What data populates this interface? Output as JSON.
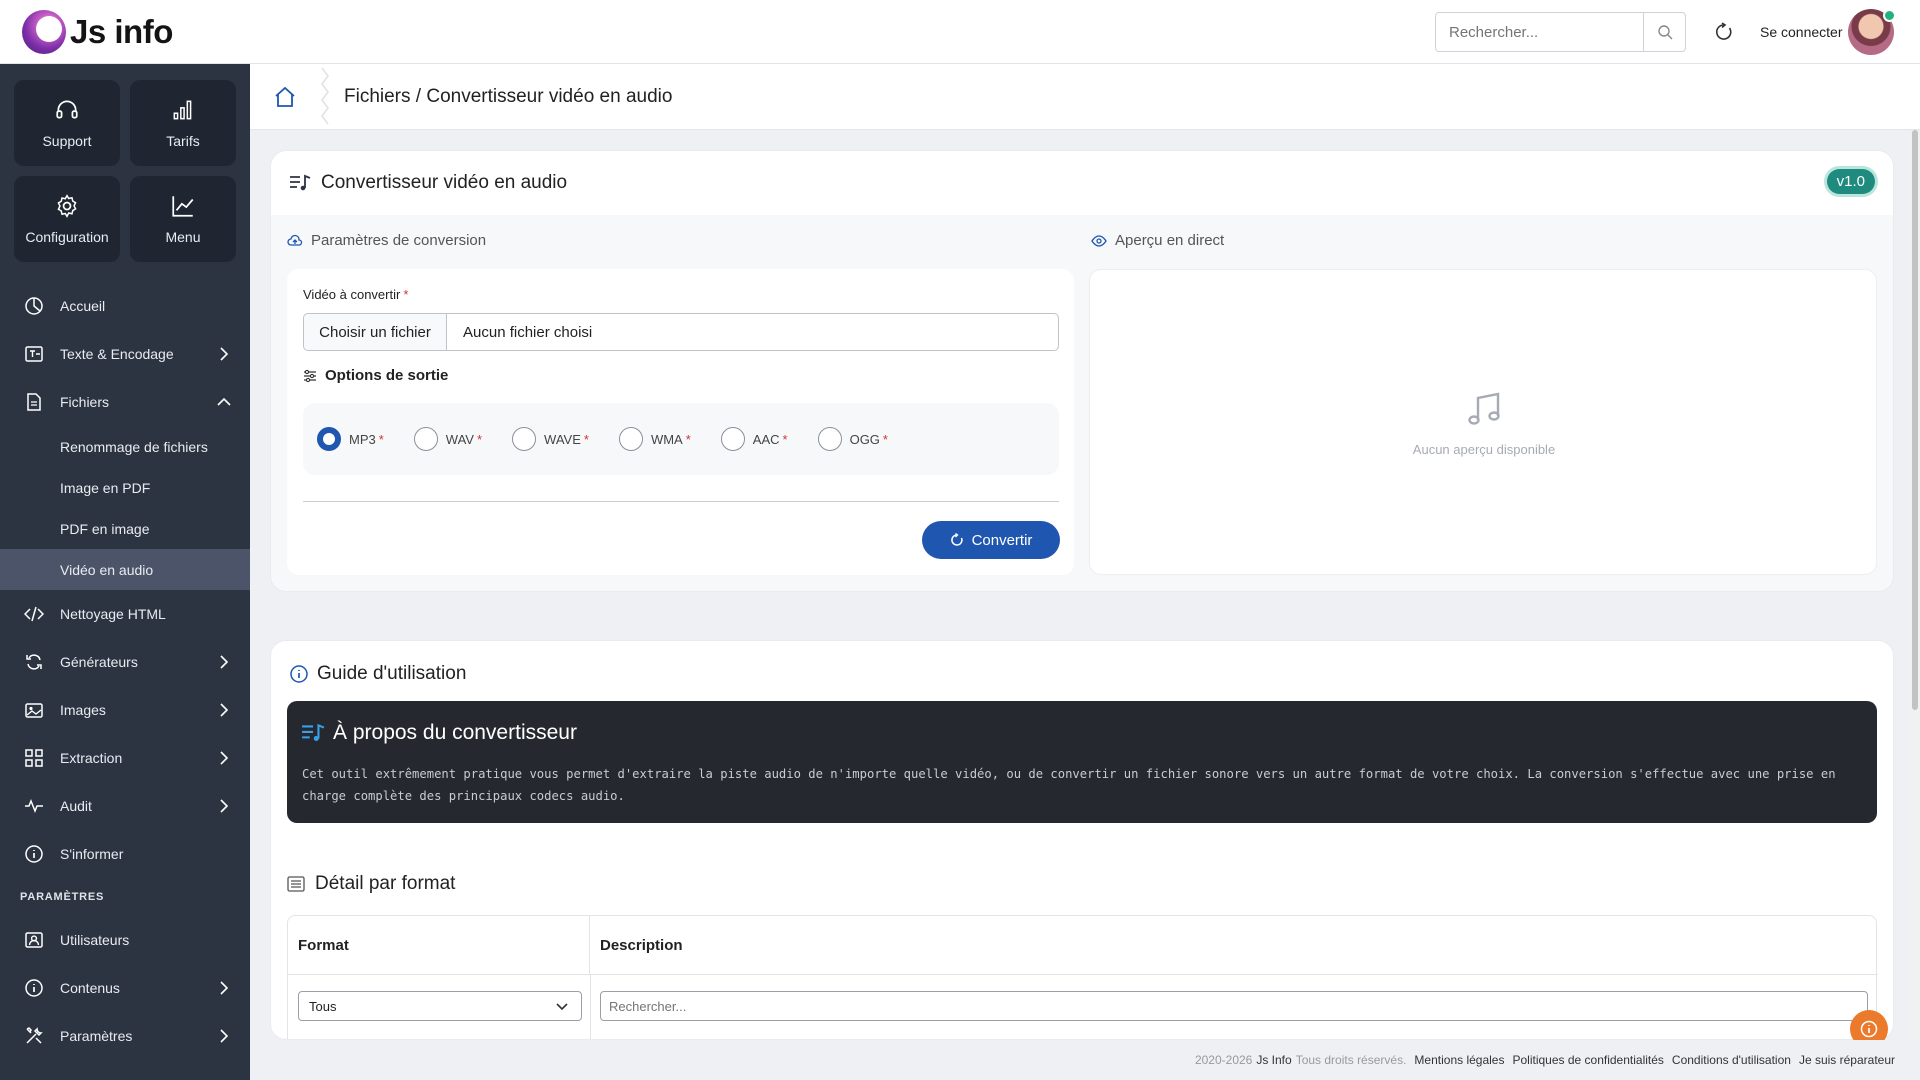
{
  "header": {
    "brand": "Js info",
    "search_placeholder": "Rechercher...",
    "login": "Se connecter"
  },
  "sidebar": {
    "tiles": [
      {
        "label": "Support",
        "icon": "headset-icon"
      },
      {
        "label": "Tarifs",
        "icon": "bar-chart-icon"
      },
      {
        "label": "Configuration",
        "icon": "gear-icon"
      },
      {
        "label": "Menu",
        "icon": "trend-chart-icon"
      }
    ],
    "items": [
      {
        "label": "Accueil",
        "icon": "pie-chart-icon"
      },
      {
        "label": "Texte & Encodage",
        "icon": "translate-icon",
        "expandable": true
      },
      {
        "label": "Fichiers",
        "icon": "files-icon",
        "expandable": true,
        "expanded": true,
        "children": [
          "Renommage de fichiers",
          "Image en PDF",
          "PDF en image",
          "Vidéo en audio"
        ]
      },
      {
        "label": "Nettoyage HTML",
        "icon": "code-icon"
      },
      {
        "label": "Générateurs",
        "icon": "cycle-icon",
        "expandable": true
      },
      {
        "label": "Images",
        "icon": "image-icon",
        "expandable": true
      },
      {
        "label": "Extraction",
        "icon": "grid-icon",
        "expandable": true
      },
      {
        "label": "Audit",
        "icon": "pulse-icon",
        "expandable": true
      },
      {
        "label": "S'informer",
        "icon": "info-icon"
      }
    ],
    "active_child": "Vidéo en audio",
    "section_label": "PARAMÈTRES",
    "settings_items": [
      {
        "label": "Utilisateurs",
        "icon": "user-card-icon"
      },
      {
        "label": "Contenus",
        "icon": "info-icon",
        "expandable": true
      },
      {
        "label": "Paramètres",
        "icon": "tools-icon",
        "expandable": true
      }
    ]
  },
  "breadcrumb": "Fichiers / Convertisseur vidéo en audio",
  "converter": {
    "title": "Convertisseur vidéo en audio",
    "version": "v1.0",
    "params_label": "Paramètres de conversion",
    "preview_label": "Aperçu en direct",
    "video_label": "Vidéo à convertir",
    "file_button": "Choisir un fichier",
    "file_status": "Aucun fichier choisi",
    "options_title": "Options de sortie",
    "formats": [
      "MP3",
      "WAV",
      "WAVE",
      "WMA",
      "AAC",
      "OGG"
    ],
    "selected_format": "MP3",
    "convert_button": "Convertir",
    "preview_empty": "Aucun aperçu disponible"
  },
  "guide": {
    "title": "Guide d'utilisation",
    "about_title": "À propos du convertisseur",
    "about_text": "Cet outil extrêmement pratique vous permet d'extraire la piste audio de n'importe quelle vidéo, ou de convertir un fichier sonore vers un autre format de votre choix. La conversion s'effectue avec une prise en charge complète des principaux codecs audio.",
    "detail_title": "Détail par format",
    "columns": [
      "Format",
      "Description"
    ],
    "filter_value": "Tous",
    "filter_search_placeholder": "Rechercher..."
  },
  "footer": {
    "copyright_years": "2020-2026",
    "company": "Js Info",
    "rights": "Tous droits réservés.",
    "links": [
      "Mentions légales",
      "Politiques de confidentialités",
      "Conditions d'utilisation",
      "Je suis réparateur"
    ]
  },
  "colors": {
    "sidebar_bg": "#2c3341",
    "accent": "#1f56b0",
    "badge": "#1f8b7e",
    "fab": "#ec7a2c"
  }
}
